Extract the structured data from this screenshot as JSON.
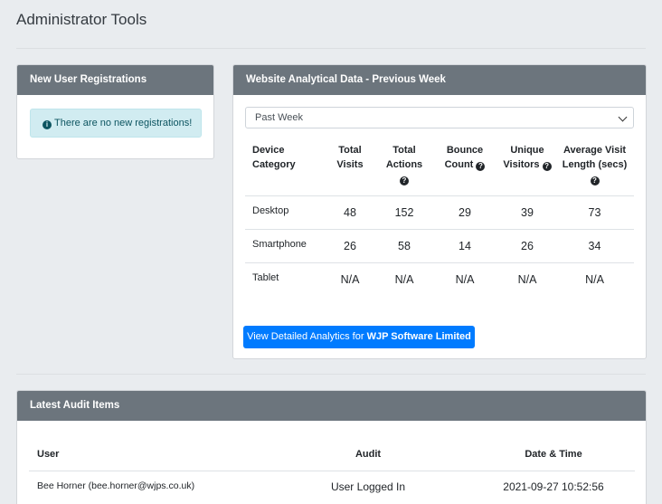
{
  "page": {
    "title": "Administrator Tools"
  },
  "registrations": {
    "header": "New User Registrations",
    "alert_icon": "info-circle-icon",
    "alert_text": "There are no new registrations!"
  },
  "analytics": {
    "header": "Website Analytical Data - Previous Week",
    "period_selected": "Past Week",
    "columns": [
      {
        "line1": "Device",
        "line2": "Category",
        "help": false
      },
      {
        "line1": "Total",
        "line2": "Visits",
        "help": false
      },
      {
        "line1": "Total",
        "line2": "Actions",
        "help": true
      },
      {
        "line1": "Bounce",
        "line2": "Count",
        "help": true
      },
      {
        "line1": "Unique",
        "line2": "Visitors",
        "help": true
      },
      {
        "line1": "Average Visit",
        "line2": "Length (secs)",
        "help": true
      }
    ],
    "rows": [
      {
        "device": "Desktop",
        "visits": "48",
        "actions": "152",
        "bounce": "29",
        "unique": "39",
        "avg_length": "73"
      },
      {
        "device": "Smartphone",
        "visits": "26",
        "actions": "58",
        "bounce": "14",
        "unique": "26",
        "avg_length": "34"
      },
      {
        "device": "Tablet",
        "visits": "N/A",
        "actions": "N/A",
        "bounce": "N/A",
        "unique": "N/A",
        "avg_length": "N/A"
      }
    ],
    "button_prefix": "View Detailed Analytics for ",
    "button_company": "WJP Software Limited"
  },
  "audit": {
    "header": "Latest Audit Items",
    "columns": {
      "user": "User",
      "audit": "Audit",
      "datetime": "Date & Time"
    },
    "rows": [
      {
        "user": "Bee Horner (bee.horner@wjps.co.uk)",
        "audit": "User Logged In",
        "datetime": "2021-09-27 10:52:56"
      }
    ]
  },
  "colors": {
    "page_bg": "#e9ecef",
    "card_header": "#6c757d",
    "primary_button": "#007bff",
    "info_alert_bg": "#d1ecf1",
    "info_alert_text": "#0c5460"
  }
}
